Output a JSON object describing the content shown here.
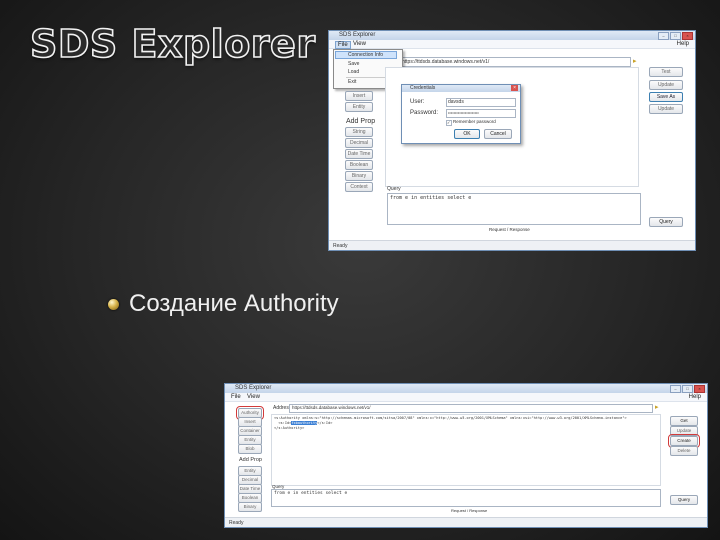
{
  "slide": {
    "title": "SDS Explorer",
    "bullet": "Создание Authority"
  },
  "win1": {
    "title": "SDS Explorer",
    "menu": {
      "file": "File",
      "view": "View",
      "help": "Help"
    },
    "file_menu": [
      "Connection Info",
      "Save",
      "Load",
      "Exit"
    ],
    "address": "https://ttdsds.database.windows.net/v1/",
    "left_buttons": [
      "Insert",
      "Entity"
    ],
    "addprop_label": "Add Prop",
    "prop_buttons": [
      "String",
      "Decimal",
      "Date Time",
      "Boolean",
      "Binary",
      "Context"
    ],
    "right_buttons": [
      "Test",
      "Update",
      "Save As",
      "Update"
    ],
    "dialog": {
      "title": "Credentials",
      "user_label": "User:",
      "user_value": "davsds",
      "password_label": "Password:",
      "password_value": "••••••••••••••••••••••",
      "remember": "Remember password",
      "ok": "OK",
      "cancel": "Cancel"
    },
    "query_label": "Query",
    "query_text": "from e in entities select e",
    "query_button": "Query",
    "resize_hint": "Request / Response",
    "status": "Ready"
  },
  "win2": {
    "title": "SDS Explorer",
    "menu": {
      "file": "File",
      "view": "View",
      "help": "Help"
    },
    "address_label": "Address",
    "address": "https://ttdsds.database.windows.net/v1/",
    "left_buttons": [
      "Authority",
      "Insert",
      "Container",
      "Entity",
      "Blob"
    ],
    "addprop_label": "Add Prop",
    "prop_buttons": [
      "Entity",
      "Decimal",
      "Date Time",
      "Boolean",
      "Binary"
    ],
    "right_buttons": [
      "Get",
      "Update",
      "Create",
      "Delete"
    ],
    "xml_lines": [
      "<s:Authority xmlns:s=\"http://schemas.microsoft.com/sitsa/2007/08\" xmlns:x=\"http://www.w3.org/2001/XMLSchema\" xmlns:xsi=\"http://www.w3.org/2001/XMLSchema-instance\">",
      "  <s:Id>fxbauthority</s:Id>",
      "</s:Authority>"
    ],
    "highlight": "fxbauthority",
    "query_label": "Query",
    "query_text": "from e in entities select e",
    "query_button": "Query",
    "resize_hint": "Request / Response",
    "status": "Ready"
  }
}
